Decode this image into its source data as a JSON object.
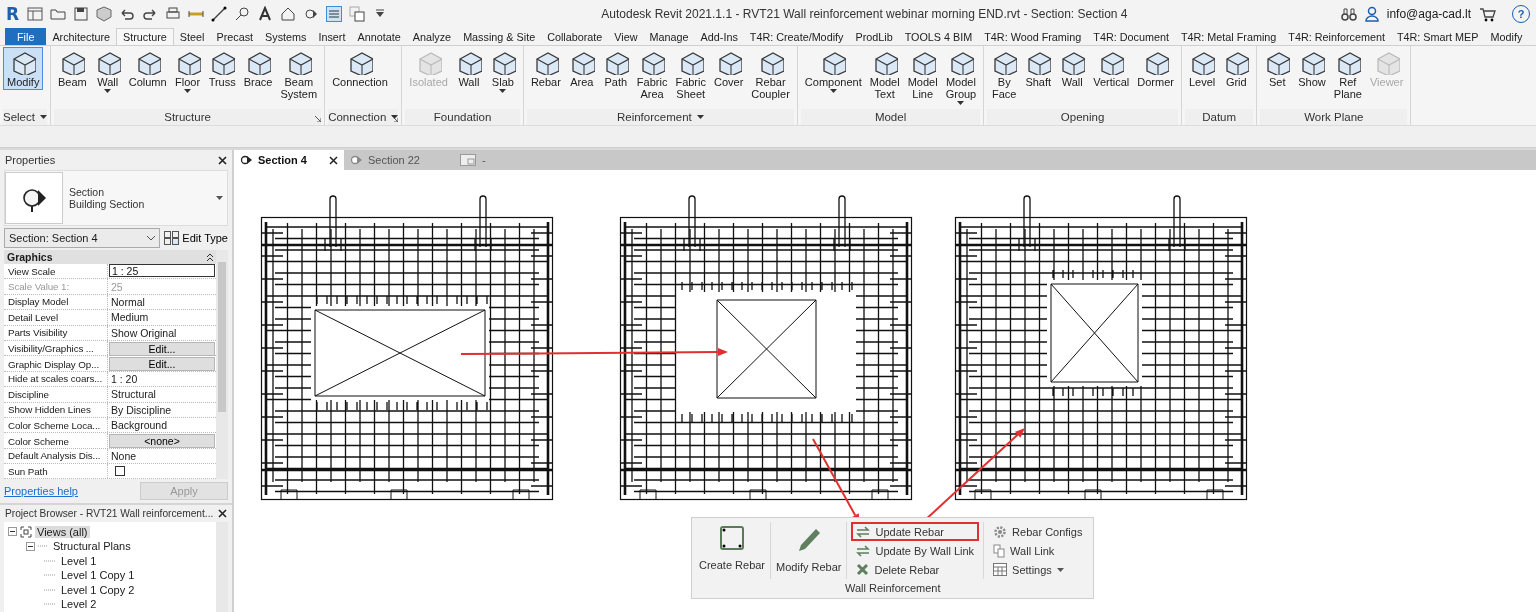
{
  "title_bar": {
    "logo": "R",
    "title": "Autodesk Revit 2021.1.1 - RVT21 Wall reinforcement webinar morning END.rvt - Section: Section 4",
    "user": "info@aga-cad.lt",
    "help": "?"
  },
  "menu_tabs": [
    {
      "label": "File",
      "kind": "file",
      "selected": false
    },
    {
      "label": "Architecture",
      "kind": "tab",
      "selected": false
    },
    {
      "label": "Structure",
      "kind": "tab",
      "selected": true
    },
    {
      "label": "Steel",
      "kind": "tab",
      "selected": false
    },
    {
      "label": "Precast",
      "kind": "tab",
      "selected": false
    },
    {
      "label": "Systems",
      "kind": "tab",
      "selected": false
    },
    {
      "label": "Insert",
      "kind": "tab",
      "selected": false
    },
    {
      "label": "Annotate",
      "kind": "tab",
      "selected": false
    },
    {
      "label": "Analyze",
      "kind": "tab",
      "selected": false
    },
    {
      "label": "Massing & Site",
      "kind": "tab",
      "selected": false
    },
    {
      "label": "Collaborate",
      "kind": "tab",
      "selected": false
    },
    {
      "label": "View",
      "kind": "tab",
      "selected": false
    },
    {
      "label": "Manage",
      "kind": "tab",
      "selected": false
    },
    {
      "label": "Add-Ins",
      "kind": "tab",
      "selected": false
    },
    {
      "label": "T4R: Create/Modify",
      "kind": "tab",
      "selected": false
    },
    {
      "label": "ProdLib",
      "kind": "tab",
      "selected": false
    },
    {
      "label": "TOOLS 4 BIM",
      "kind": "tab",
      "selected": false
    },
    {
      "label": "T4R: Wood Framing",
      "kind": "tab",
      "selected": false
    },
    {
      "label": "T4R: Document",
      "kind": "tab",
      "selected": false
    },
    {
      "label": "T4R: Metal Framing",
      "kind": "tab",
      "selected": false
    },
    {
      "label": "T4R: Reinforcement",
      "kind": "tab",
      "selected": false
    },
    {
      "label": "T4R: Smart MEP",
      "kind": "tab",
      "selected": false
    },
    {
      "label": "Modify",
      "kind": "tab",
      "selected": false
    }
  ],
  "ribbon": [
    {
      "title": "Select",
      "menu": true,
      "launcher": false,
      "buttons": [
        {
          "label": "Modify",
          "selected": true,
          "disabled": false,
          "dropdown": false
        }
      ]
    },
    {
      "title": "Structure",
      "menu": false,
      "launcher": true,
      "buttons": [
        {
          "label": "Beam",
          "selected": false,
          "disabled": false,
          "dropdown": false
        },
        {
          "label": "Wall",
          "selected": false,
          "disabled": false,
          "dropdown": true
        },
        {
          "label": "Column",
          "selected": false,
          "disabled": false,
          "dropdown": false
        },
        {
          "label": "Floor",
          "selected": false,
          "disabled": false,
          "dropdown": true
        },
        {
          "label": "Truss",
          "selected": false,
          "disabled": false,
          "dropdown": false
        },
        {
          "label": "Brace",
          "selected": false,
          "disabled": false,
          "dropdown": false
        },
        {
          "label": "Beam\nSystem",
          "selected": false,
          "disabled": false,
          "dropdown": false
        }
      ]
    },
    {
      "title": "Connection",
      "menu": true,
      "launcher": true,
      "buttons": [
        {
          "label": "Connection",
          "selected": false,
          "disabled": false,
          "dropdown": false
        }
      ]
    },
    {
      "title": "Foundation",
      "menu": false,
      "launcher": false,
      "buttons": [
        {
          "label": "Isolated",
          "selected": false,
          "disabled": true,
          "dropdown": false
        },
        {
          "label": "Wall",
          "selected": false,
          "disabled": false,
          "dropdown": false
        },
        {
          "label": "Slab",
          "selected": false,
          "disabled": false,
          "dropdown": true
        }
      ]
    },
    {
      "title": "Reinforcement",
      "menu": true,
      "launcher": false,
      "buttons": [
        {
          "label": "Rebar",
          "selected": false,
          "disabled": false,
          "dropdown": false
        },
        {
          "label": "Area",
          "selected": false,
          "disabled": false,
          "dropdown": false
        },
        {
          "label": "Path",
          "selected": false,
          "disabled": false,
          "dropdown": false
        },
        {
          "label": "Fabric\nArea",
          "selected": false,
          "disabled": false,
          "dropdown": false
        },
        {
          "label": "Fabric\nSheet",
          "selected": false,
          "disabled": false,
          "dropdown": false
        },
        {
          "label": "Cover",
          "selected": false,
          "disabled": false,
          "dropdown": false
        },
        {
          "label": "Rebar\nCoupler",
          "selected": false,
          "disabled": false,
          "dropdown": false
        }
      ]
    },
    {
      "title": "Model",
      "menu": false,
      "launcher": false,
      "buttons": [
        {
          "label": "Component",
          "selected": false,
          "disabled": false,
          "dropdown": true
        },
        {
          "label": "Model\nText",
          "selected": false,
          "disabled": false,
          "dropdown": false
        },
        {
          "label": "Model\nLine",
          "selected": false,
          "disabled": false,
          "dropdown": false
        },
        {
          "label": "Model\nGroup",
          "selected": false,
          "disabled": false,
          "dropdown": true
        }
      ]
    },
    {
      "title": "Opening",
      "menu": false,
      "launcher": false,
      "buttons": [
        {
          "label": "By\nFace",
          "selected": false,
          "disabled": false,
          "dropdown": false
        },
        {
          "label": "Shaft",
          "selected": false,
          "disabled": false,
          "dropdown": false
        },
        {
          "label": "Wall",
          "selected": false,
          "disabled": false,
          "dropdown": false
        },
        {
          "label": "Vertical",
          "selected": false,
          "disabled": false,
          "dropdown": false
        },
        {
          "label": "Dormer",
          "selected": false,
          "disabled": false,
          "dropdown": false
        }
      ]
    },
    {
      "title": "Datum",
      "menu": false,
      "launcher": false,
      "buttons": [
        {
          "label": "Level",
          "selected": false,
          "disabled": false,
          "dropdown": false
        },
        {
          "label": "Grid",
          "selected": false,
          "disabled": false,
          "dropdown": false
        }
      ]
    },
    {
      "title": "Work Plane",
      "menu": false,
      "launcher": false,
      "buttons": [
        {
          "label": "Set",
          "selected": false,
          "disabled": false,
          "dropdown": false
        },
        {
          "label": "Show",
          "selected": false,
          "disabled": false,
          "dropdown": false
        },
        {
          "label": "Ref\nPlane",
          "selected": false,
          "disabled": false,
          "dropdown": false
        },
        {
          "label": "Viewer",
          "selected": false,
          "disabled": true,
          "dropdown": false
        }
      ]
    }
  ],
  "properties": {
    "title": "Properties",
    "type_name": "Section",
    "type_family": "Building Section",
    "instance": "Section: Section 4",
    "edit_type": "Edit Type",
    "group": "Graphics",
    "rows": [
      {
        "name": "View Scale",
        "value": "1 : 25",
        "kind": "input"
      },
      {
        "name": "Scale Value    1:",
        "value": "25",
        "kind": "readonly"
      },
      {
        "name": "Display Model",
        "value": "Normal",
        "kind": "text"
      },
      {
        "name": "Detail Level",
        "value": "Medium",
        "kind": "text"
      },
      {
        "name": "Parts Visibility",
        "value": "Show Original",
        "kind": "text"
      },
      {
        "name": "Visibility/Graphics ...",
        "value": "Edit...",
        "kind": "button"
      },
      {
        "name": "Graphic Display Op...",
        "value": "Edit...",
        "kind": "button"
      },
      {
        "name": "Hide at scales coars...",
        "value": "1 : 20",
        "kind": "text"
      },
      {
        "name": "Discipline",
        "value": "Structural",
        "kind": "text"
      },
      {
        "name": "Show Hidden Lines",
        "value": "By Discipline",
        "kind": "text"
      },
      {
        "name": "Color Scheme Loca...",
        "value": "Background",
        "kind": "text"
      },
      {
        "name": "Color Scheme",
        "value": "<none>",
        "kind": "button"
      },
      {
        "name": "Default Analysis Dis...",
        "value": "None",
        "kind": "text"
      },
      {
        "name": "Sun Path",
        "checked": false,
        "kind": "checkbox"
      }
    ],
    "help_link": "Properties help",
    "apply": "Apply",
    "apply_disabled": true
  },
  "project_browser": {
    "title": "Project Browser - RVT21 Wall reinforcement...",
    "tree": [
      {
        "label": "Views (all)",
        "expanded": true,
        "selected": true,
        "children": [
          {
            "label": "Structural Plans",
            "expanded": true,
            "selected": false,
            "children": [
              {
                "label": "Level 1",
                "selected": false
              },
              {
                "label": "Level 1 Copy 1",
                "selected": false
              },
              {
                "label": "Level 1 Copy 2",
                "selected": false
              },
              {
                "label": "Level 2",
                "selected": false
              }
            ]
          }
        ]
      }
    ]
  },
  "view_tabs": [
    {
      "label": "Section 4",
      "kind": "section",
      "selected": true
    },
    {
      "label": "Section 22",
      "kind": "section",
      "selected": false
    },
    {
      "label": "-",
      "kind": "sheet",
      "selected": false
    }
  ],
  "wall_reinforcement_panel": {
    "title": "Wall Reinforcement",
    "large_buttons": [
      {
        "label": "Create Rebar",
        "kind": "create"
      },
      {
        "label": "Modify Rebar",
        "kind": "modify"
      }
    ],
    "columns": [
      [
        {
          "label": "Update Rebar",
          "kind": "update",
          "highlighted": true,
          "dropdown": false
        },
        {
          "label": "Update By Wall Link",
          "kind": "update",
          "highlighted": false,
          "dropdown": false
        },
        {
          "label": "Delete Rebar",
          "kind": "delete",
          "highlighted": false,
          "dropdown": false
        }
      ],
      [
        {
          "label": "Rebar Configs",
          "kind": "gear",
          "highlighted": false,
          "dropdown": false
        },
        {
          "label": "Wall Link",
          "kind": "link",
          "highlighted": false,
          "dropdown": false
        },
        {
          "label": "Settings",
          "kind": "grid",
          "highlighted": false,
          "dropdown": true
        }
      ]
    ]
  }
}
